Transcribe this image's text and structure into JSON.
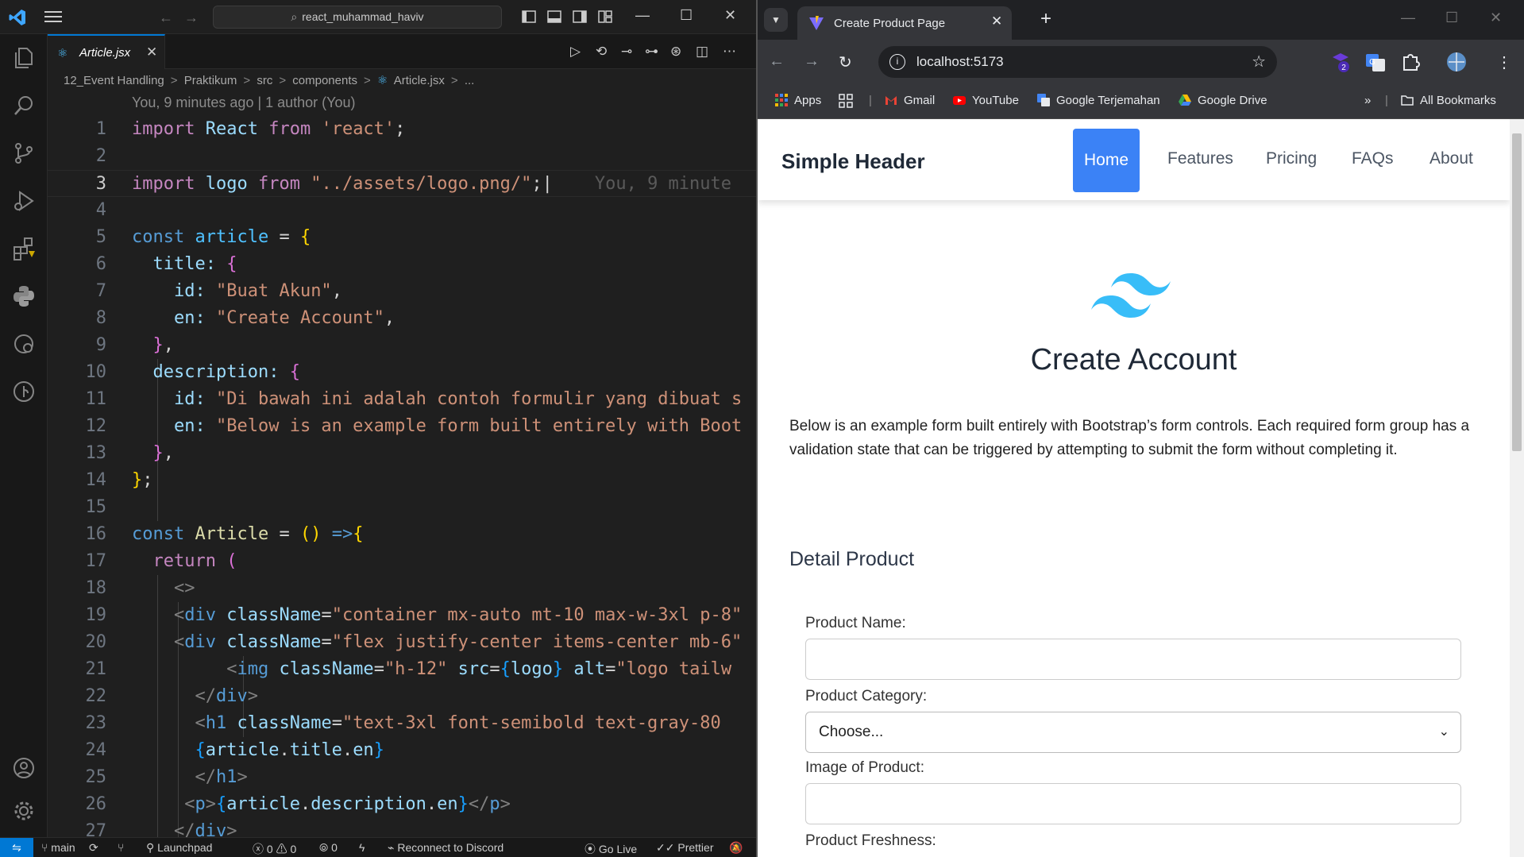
{
  "vscode": {
    "search": "react_muhammad_haviv",
    "tab": "Article.jsx",
    "breadcrumb": [
      "12_Event Handling",
      "Praktikum",
      "src",
      "components",
      "Article.jsx",
      "..."
    ],
    "blame": "You, 9 minutes ago | 1 author (You)",
    "ghost_blame": "You, 9 minute",
    "lines": [
      "1",
      "2",
      "3",
      "4",
      "5",
      "6",
      "7",
      "8",
      "9",
      "10",
      "11",
      "12",
      "13",
      "14",
      "15",
      "16",
      "17",
      "18",
      "19",
      "20",
      "21",
      "22",
      "23",
      "24",
      "25",
      "26",
      "27"
    ],
    "code": {
      "l1": [
        "import",
        "React",
        "from",
        "'react'",
        ";"
      ],
      "l3": [
        "import",
        "logo",
        "from",
        "\"../assets/logo.png/\"",
        ";"
      ],
      "l5": [
        "const",
        "article",
        "=",
        "{"
      ],
      "l6": [
        "title:",
        "{"
      ],
      "l7": [
        "id:",
        "\"Buat Akun\"",
        ","
      ],
      "l8": [
        "en:",
        "\"Create Account\"",
        ","
      ],
      "l9": [
        "}",
        ","
      ],
      "l10": [
        "description:",
        "{"
      ],
      "l11": [
        "id:",
        "\"Di bawah ini adalah contoh formulir yang dibuat s"
      ],
      "l12": [
        "en:",
        "\"Below is an example form built entirely with Boot"
      ],
      "l13": [
        "}",
        ","
      ],
      "l14": [
        "}",
        ";"
      ],
      "l16": [
        "const",
        "Article",
        "=",
        "()",
        "=>",
        "{"
      ],
      "l17": [
        "return",
        "("
      ],
      "l18": [
        "<>"
      ],
      "l19": [
        "<",
        "div",
        "className",
        "=",
        "\"container mx-auto mt-10 max-w-3xl p-8\""
      ],
      "l20": [
        "<",
        "div",
        "className",
        "=",
        "\"flex justify-center items-center mb-6\""
      ],
      "l21": [
        "<",
        "img",
        "className",
        "=",
        "\"h-12\"",
        "src",
        "=",
        "{",
        "logo",
        "}",
        "alt",
        "=",
        "\"logo tailw"
      ],
      "l22": [
        "</",
        "div",
        ">"
      ],
      "l23": [
        "<",
        "h1",
        "className",
        "=",
        "\"text-3xl font-semibold text-gray-80"
      ],
      "l24": [
        "{",
        "article",
        ".",
        "title",
        ".",
        "en",
        "}"
      ],
      "l25": [
        "</",
        "h1",
        ">"
      ],
      "l26": [
        "<",
        "p",
        ">",
        "{",
        "article",
        ".",
        "description",
        ".",
        "en",
        "}",
        "</",
        "p",
        ">"
      ],
      "l27": [
        "</",
        "div",
        ">"
      ]
    },
    "status": {
      "branch": "main",
      "launchpad": "Launchpad",
      "errors": "0",
      "warnings": "0",
      "ports": "0",
      "discord": "Reconnect to Discord",
      "golive": "Go Live",
      "prettier": "Prettier"
    }
  },
  "chrome": {
    "tab_title": "Create Product Page",
    "url": "localhost:5173",
    "ext_badge": "2",
    "bookmarks": [
      "Apps",
      "Gmail",
      "YouTube",
      "Google Terjemahan",
      "Google Drive"
    ],
    "all_bookmarks": "All Bookmarks"
  },
  "site": {
    "brand": "Simple Header",
    "nav": [
      "Home",
      "Features",
      "Pricing",
      "FAQs",
      "About"
    ],
    "title": "Create Account",
    "description": "Below is an example form built entirely with Bootstrap’s form controls. Each required form group has a validation state that can be triggered by attempting to submit the form without completing it.",
    "section": "Detail Product",
    "labels": {
      "name": "Product Name:",
      "category": "Product Category:",
      "image": "Image of Product:",
      "freshness": "Product Freshness:"
    },
    "category_value": "Choose..."
  }
}
